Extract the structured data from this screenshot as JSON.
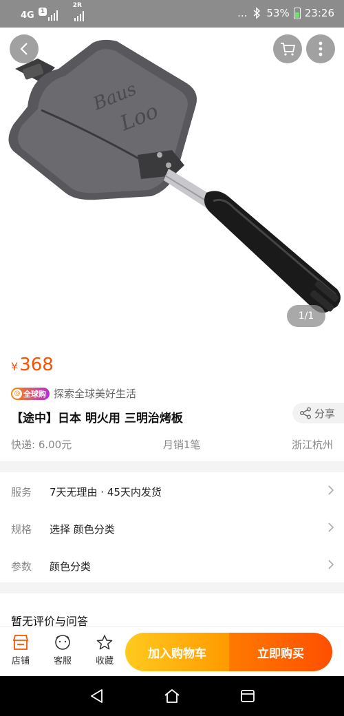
{
  "status_bar": {
    "network": "4G",
    "sim_badge": "1",
    "sim2_label": "2R",
    "dots": "...",
    "battery": "53%",
    "time": "23:26"
  },
  "hero": {
    "brand_script": "Baus Loo",
    "pager": "1/1"
  },
  "product": {
    "currency": "¥",
    "price": "368",
    "global_badge": "全球购",
    "global_slogan": "探索全球美好生活",
    "title": "【途中】日本 明火用 三明治烤板",
    "share_label": "分享",
    "shipping": "快递: 6.00元",
    "monthly_sales": "月销1笔",
    "location": "浙江杭州"
  },
  "specs": [
    {
      "key": "服务",
      "value": "7天无理由 · 45天内发货"
    },
    {
      "key": "规格",
      "value": "选择 颜色分类"
    },
    {
      "key": "参数",
      "value": "颜色分类"
    }
  ],
  "review": {
    "title": "暂无评价与问答"
  },
  "action_bar": {
    "shop": "店铺",
    "service": "客服",
    "favorite": "收藏",
    "add_to_cart": "加入购物车",
    "buy_now": "立即购买"
  },
  "colors": {
    "accent_orange": "#ff5000",
    "cart_button": "#ffb000",
    "buy_button": "#ff5a00"
  },
  "icons": [
    "back-icon",
    "cart-icon",
    "more-icon",
    "share-icon",
    "chevron-right-icon",
    "shop-icon",
    "service-icon",
    "star-icon",
    "nav-back-icon",
    "nav-home-icon",
    "nav-recent-icon"
  ]
}
